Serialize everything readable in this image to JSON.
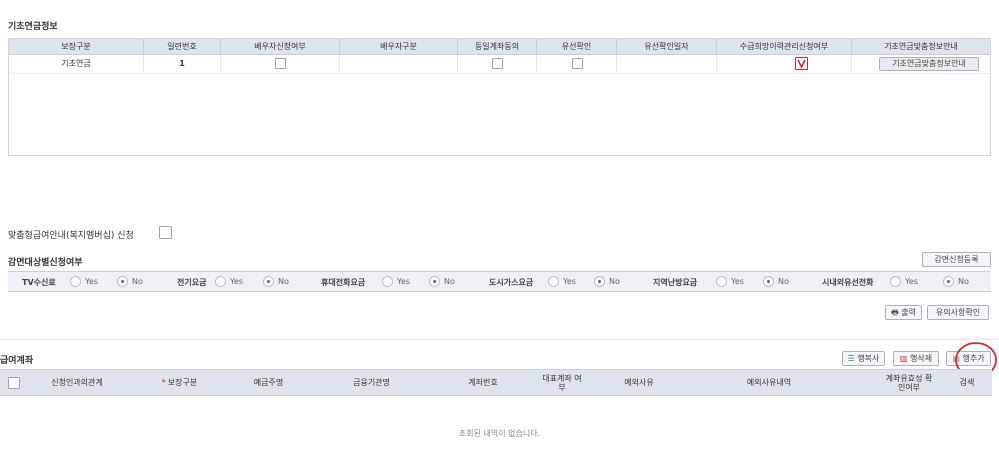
{
  "basic_pension": {
    "title": "기초연금정보",
    "columns": [
      "보장구분",
      "일련번호",
      "배우자신청여부",
      "배우자구분",
      "동일계좌동의",
      "유선확인",
      "유선확인일자",
      "수급희망이력관리신청여부",
      "기초연금맞춤정보안내"
    ],
    "row": {
      "type": "기초연금",
      "serial": "1",
      "spouse_apply": false,
      "spouse_type": "",
      "same_account": false,
      "phone_confirm": false,
      "phone_date": "",
      "history_mgmt": true,
      "info_button": "기초연금맞춤정보안내"
    }
  },
  "custom_benefit": {
    "label": "맞춤형급여안내(복지멤버십) 신청",
    "checked": false
  },
  "reduction": {
    "title": "감면대상별신청여부",
    "register_button": "감면신청등록",
    "yes_label": "Yes",
    "no_label": "No",
    "items": [
      {
        "label": "TV수신료",
        "value": "No"
      },
      {
        "label": "전기요금",
        "value": "No"
      },
      {
        "label": "휴대전화요금",
        "value": "No"
      },
      {
        "label": "도시가스요금",
        "value": "No"
      },
      {
        "label": "지역난방요금",
        "value": "No"
      },
      {
        "label": "시내외유선전화",
        "value": "No"
      }
    ],
    "print_button": "출력",
    "notice_button": "유의사항확인"
  },
  "account": {
    "title": "급여계좌",
    "copy_button": "행복사",
    "delete_button": "행삭제",
    "add_button": "행추가",
    "columns": [
      "신청인과의관계",
      "보장구분",
      "예금주명",
      "금융기관명",
      "계좌번호",
      "대표계좌 여부",
      "예외사유",
      "예외사유내역",
      "계좌유효성 확인여부",
      "검색"
    ],
    "required_marker": "*",
    "empty_message": "조회된 내역이 없습니다."
  },
  "colors": {
    "header_bg": "#dde4eb",
    "annotation_red": "#d8262c"
  }
}
